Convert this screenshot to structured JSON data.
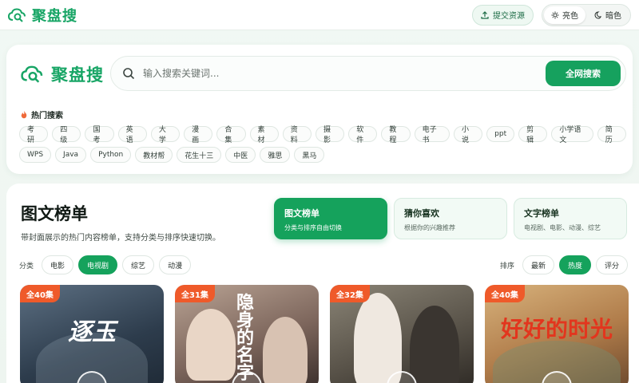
{
  "header": {
    "brand": "聚盘搜",
    "submit_label": "提交资源",
    "theme_light": "亮色",
    "theme_dark": "暗色"
  },
  "search": {
    "brand": "聚盘搜",
    "placeholder": "输入搜索关键词...",
    "button": "全网搜索",
    "hot_title": "热门搜索",
    "hot_tags_row1": [
      "考研",
      "四级",
      "国考",
      "英语",
      "大学",
      "漫画",
      "合集",
      "素材",
      "资料",
      "摄影",
      "软件",
      "教程",
      "电子书",
      "小说",
      "ppt",
      "剪辑",
      "小学语文",
      "简历"
    ],
    "hot_tags_row2": [
      "WPS",
      "Java",
      "Python",
      "教材帮",
      "花生十三",
      "中医",
      "雅思",
      "黑马"
    ]
  },
  "ranking": {
    "title": "图文榜单",
    "description": "带封面展示的热门内容榜单，支持分类与排序快速切换。",
    "modes": [
      {
        "name": "图文榜单",
        "sub": "分类与排序自由切换",
        "active": true
      },
      {
        "name": "猜你喜欢",
        "sub": "根据你的兴趣推荐",
        "active": false
      },
      {
        "name": "文字榜单",
        "sub": "电视剧、电影、动漫、综艺",
        "active": false
      }
    ],
    "category_label": "分类",
    "categories": [
      "电影",
      "电视剧",
      "综艺",
      "动漫"
    ],
    "active_category": "电视剧",
    "sort_label": "排序",
    "sorts": [
      "最新",
      "热度",
      "评分"
    ],
    "active_sort": "热度",
    "posters": [
      {
        "badge": "全40集",
        "title": "逐玉"
      },
      {
        "badge": "全31集",
        "title": "隐身的名字"
      },
      {
        "badge": "全32集",
        "title": ""
      },
      {
        "badge": "全40集",
        "title": "好好的时光"
      }
    ]
  },
  "colors": {
    "accent": "#16a15e",
    "badge": "#ef5a2a"
  }
}
